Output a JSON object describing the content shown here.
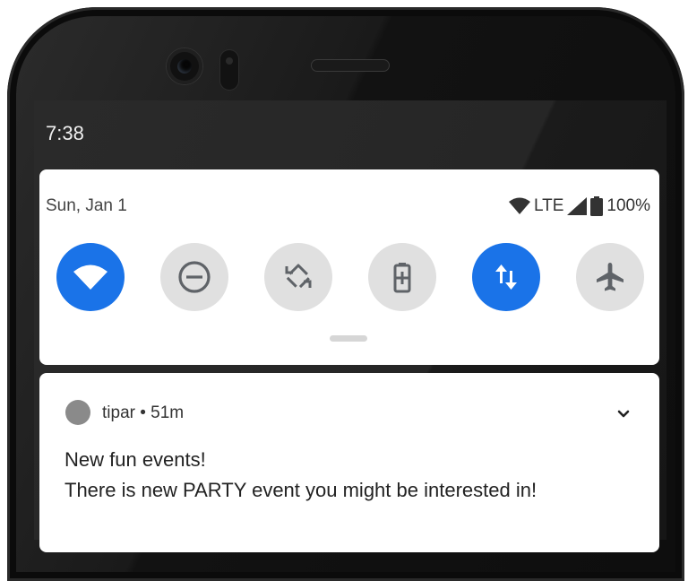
{
  "status_bar": {
    "time": "7:38"
  },
  "quick_settings": {
    "date": "Sun, Jan 1",
    "network_label": "LTE",
    "battery_percent": "100%",
    "tiles": [
      {
        "icon": "wifi-icon",
        "active": true
      },
      {
        "icon": "do-not-disturb-icon",
        "active": false
      },
      {
        "icon": "auto-rotate-icon",
        "active": false
      },
      {
        "icon": "battery-saver-icon",
        "active": false
      },
      {
        "icon": "mobile-data-icon",
        "active": true
      },
      {
        "icon": "airplane-mode-icon",
        "active": false
      }
    ]
  },
  "notification": {
    "app_line": "tipar • 51m",
    "title": "New fun events!",
    "body": "There is new PARTY event you might be interested in!"
  },
  "colors": {
    "accent": "#1a73e8",
    "tile_inactive": "#e0e0e0"
  }
}
